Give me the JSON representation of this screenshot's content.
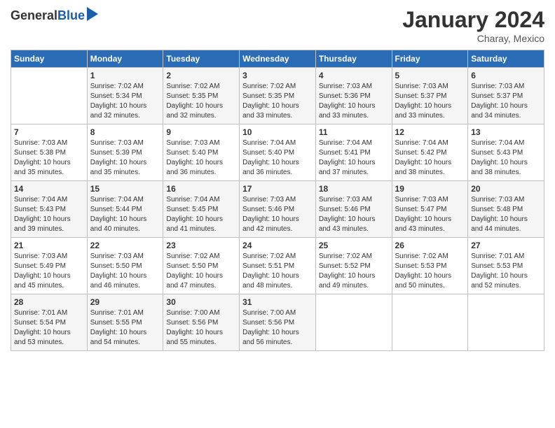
{
  "header": {
    "logo_general": "General",
    "logo_blue": "Blue",
    "month": "January 2024",
    "location": "Charay, Mexico"
  },
  "weekdays": [
    "Sunday",
    "Monday",
    "Tuesday",
    "Wednesday",
    "Thursday",
    "Friday",
    "Saturday"
  ],
  "weeks": [
    [
      {
        "day": "",
        "sunrise": "",
        "sunset": "",
        "daylight": ""
      },
      {
        "day": "1",
        "sunrise": "Sunrise: 7:02 AM",
        "sunset": "Sunset: 5:34 PM",
        "daylight": "Daylight: 10 hours and 32 minutes."
      },
      {
        "day": "2",
        "sunrise": "Sunrise: 7:02 AM",
        "sunset": "Sunset: 5:35 PM",
        "daylight": "Daylight: 10 hours and 32 minutes."
      },
      {
        "day": "3",
        "sunrise": "Sunrise: 7:02 AM",
        "sunset": "Sunset: 5:35 PM",
        "daylight": "Daylight: 10 hours and 33 minutes."
      },
      {
        "day": "4",
        "sunrise": "Sunrise: 7:03 AM",
        "sunset": "Sunset: 5:36 PM",
        "daylight": "Daylight: 10 hours and 33 minutes."
      },
      {
        "day": "5",
        "sunrise": "Sunrise: 7:03 AM",
        "sunset": "Sunset: 5:37 PM",
        "daylight": "Daylight: 10 hours and 33 minutes."
      },
      {
        "day": "6",
        "sunrise": "Sunrise: 7:03 AM",
        "sunset": "Sunset: 5:37 PM",
        "daylight": "Daylight: 10 hours and 34 minutes."
      }
    ],
    [
      {
        "day": "7",
        "sunrise": "Sunrise: 7:03 AM",
        "sunset": "Sunset: 5:38 PM",
        "daylight": "Daylight: 10 hours and 35 minutes."
      },
      {
        "day": "8",
        "sunrise": "Sunrise: 7:03 AM",
        "sunset": "Sunset: 5:39 PM",
        "daylight": "Daylight: 10 hours and 35 minutes."
      },
      {
        "day": "9",
        "sunrise": "Sunrise: 7:03 AM",
        "sunset": "Sunset: 5:40 PM",
        "daylight": "Daylight: 10 hours and 36 minutes."
      },
      {
        "day": "10",
        "sunrise": "Sunrise: 7:04 AM",
        "sunset": "Sunset: 5:40 PM",
        "daylight": "Daylight: 10 hours and 36 minutes."
      },
      {
        "day": "11",
        "sunrise": "Sunrise: 7:04 AM",
        "sunset": "Sunset: 5:41 PM",
        "daylight": "Daylight: 10 hours and 37 minutes."
      },
      {
        "day": "12",
        "sunrise": "Sunrise: 7:04 AM",
        "sunset": "Sunset: 5:42 PM",
        "daylight": "Daylight: 10 hours and 38 minutes."
      },
      {
        "day": "13",
        "sunrise": "Sunrise: 7:04 AM",
        "sunset": "Sunset: 5:43 PM",
        "daylight": "Daylight: 10 hours and 38 minutes."
      }
    ],
    [
      {
        "day": "14",
        "sunrise": "Sunrise: 7:04 AM",
        "sunset": "Sunset: 5:43 PM",
        "daylight": "Daylight: 10 hours and 39 minutes."
      },
      {
        "day": "15",
        "sunrise": "Sunrise: 7:04 AM",
        "sunset": "Sunset: 5:44 PM",
        "daylight": "Daylight: 10 hours and 40 minutes."
      },
      {
        "day": "16",
        "sunrise": "Sunrise: 7:04 AM",
        "sunset": "Sunset: 5:45 PM",
        "daylight": "Daylight: 10 hours and 41 minutes."
      },
      {
        "day": "17",
        "sunrise": "Sunrise: 7:03 AM",
        "sunset": "Sunset: 5:46 PM",
        "daylight": "Daylight: 10 hours and 42 minutes."
      },
      {
        "day": "18",
        "sunrise": "Sunrise: 7:03 AM",
        "sunset": "Sunset: 5:46 PM",
        "daylight": "Daylight: 10 hours and 43 minutes."
      },
      {
        "day": "19",
        "sunrise": "Sunrise: 7:03 AM",
        "sunset": "Sunset: 5:47 PM",
        "daylight": "Daylight: 10 hours and 43 minutes."
      },
      {
        "day": "20",
        "sunrise": "Sunrise: 7:03 AM",
        "sunset": "Sunset: 5:48 PM",
        "daylight": "Daylight: 10 hours and 44 minutes."
      }
    ],
    [
      {
        "day": "21",
        "sunrise": "Sunrise: 7:03 AM",
        "sunset": "Sunset: 5:49 PM",
        "daylight": "Daylight: 10 hours and 45 minutes."
      },
      {
        "day": "22",
        "sunrise": "Sunrise: 7:03 AM",
        "sunset": "Sunset: 5:50 PM",
        "daylight": "Daylight: 10 hours and 46 minutes."
      },
      {
        "day": "23",
        "sunrise": "Sunrise: 7:02 AM",
        "sunset": "Sunset: 5:50 PM",
        "daylight": "Daylight: 10 hours and 47 minutes."
      },
      {
        "day": "24",
        "sunrise": "Sunrise: 7:02 AM",
        "sunset": "Sunset: 5:51 PM",
        "daylight": "Daylight: 10 hours and 48 minutes."
      },
      {
        "day": "25",
        "sunrise": "Sunrise: 7:02 AM",
        "sunset": "Sunset: 5:52 PM",
        "daylight": "Daylight: 10 hours and 49 minutes."
      },
      {
        "day": "26",
        "sunrise": "Sunrise: 7:02 AM",
        "sunset": "Sunset: 5:53 PM",
        "daylight": "Daylight: 10 hours and 50 minutes."
      },
      {
        "day": "27",
        "sunrise": "Sunrise: 7:01 AM",
        "sunset": "Sunset: 5:53 PM",
        "daylight": "Daylight: 10 hours and 52 minutes."
      }
    ],
    [
      {
        "day": "28",
        "sunrise": "Sunrise: 7:01 AM",
        "sunset": "Sunset: 5:54 PM",
        "daylight": "Daylight: 10 hours and 53 minutes."
      },
      {
        "day": "29",
        "sunrise": "Sunrise: 7:01 AM",
        "sunset": "Sunset: 5:55 PM",
        "daylight": "Daylight: 10 hours and 54 minutes."
      },
      {
        "day": "30",
        "sunrise": "Sunrise: 7:00 AM",
        "sunset": "Sunset: 5:56 PM",
        "daylight": "Daylight: 10 hours and 55 minutes."
      },
      {
        "day": "31",
        "sunrise": "Sunrise: 7:00 AM",
        "sunset": "Sunset: 5:56 PM",
        "daylight": "Daylight: 10 hours and 56 minutes."
      },
      {
        "day": "",
        "sunrise": "",
        "sunset": "",
        "daylight": ""
      },
      {
        "day": "",
        "sunrise": "",
        "sunset": "",
        "daylight": ""
      },
      {
        "day": "",
        "sunrise": "",
        "sunset": "",
        "daylight": ""
      }
    ]
  ]
}
